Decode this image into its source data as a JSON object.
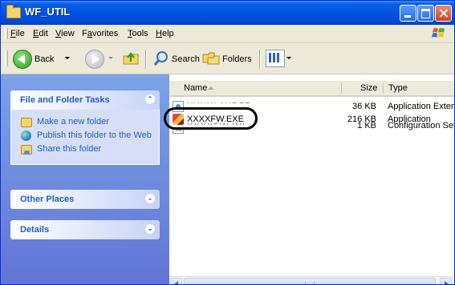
{
  "window": {
    "title": "WF_UTIL"
  },
  "menu": {
    "items": [
      {
        "pre": "",
        "ul": "F",
        "post": "ile"
      },
      {
        "pre": "",
        "ul": "E",
        "post": "dit"
      },
      {
        "pre": "",
        "ul": "V",
        "post": "iew"
      },
      {
        "pre": "F",
        "ul": "a",
        "post": "vorites"
      },
      {
        "pre": "",
        "ul": "T",
        "post": "ools"
      },
      {
        "pre": "",
        "ul": "H",
        "post": "elp"
      }
    ]
  },
  "toolbar": {
    "back_label": "Back",
    "search_label": "Search",
    "folders_label": "Folders"
  },
  "taskpane": {
    "file_tasks": {
      "title": "File and Folder Tasks",
      "items": [
        "Make a new folder",
        "Publish this folder to the Web",
        "Share this folder"
      ]
    },
    "other_places": {
      "title": "Other Places"
    },
    "details": {
      "title": "Details"
    }
  },
  "filelist": {
    "columns": {
      "name": "Name",
      "size": "Size",
      "type": "Type"
    },
    "rows": [
      {
        "name": "XXXXFW.DLL",
        "size": "36 KB",
        "type": "Application Extens",
        "icon": "dll-icon"
      },
      {
        "name": "XXXXFW.EXE",
        "size": "216 KB",
        "type": "Application",
        "icon": "exe-icon"
      },
      {
        "name": "XXXXFW.INI",
        "size": "1 KB",
        "type": "Configuration Sett",
        "icon": "ini-icon"
      }
    ]
  },
  "colors": {
    "titlebar": "#0054e3",
    "taskpane": "#6f8de0",
    "task_link": "#215dc6"
  }
}
